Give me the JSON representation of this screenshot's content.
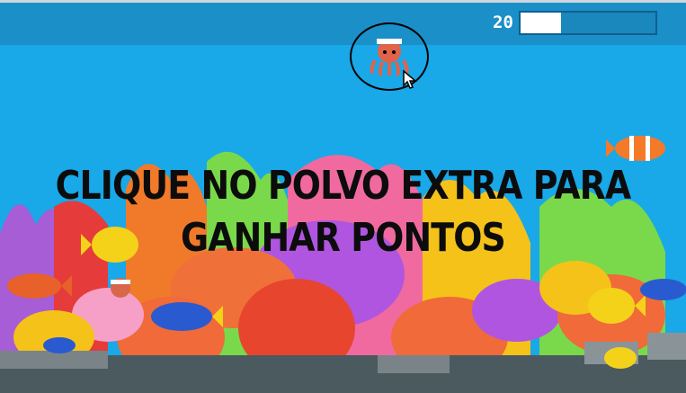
{
  "hud": {
    "score": "20",
    "progress": 0.3
  },
  "instruction": "CLIQUE NO POLVO EXTRA PARA GANHAR PONTOS",
  "icons": [
    "octopus-icon",
    "cursor-icon",
    "fish-icon"
  ],
  "colors": {
    "water": "#19a8e8",
    "bar": "#1b8fc8",
    "coral_orange": "#f47a3a",
    "coral_pink": "#f06aa0",
    "coral_purple": "#b46be6",
    "coral_green": "#7ad94a"
  }
}
